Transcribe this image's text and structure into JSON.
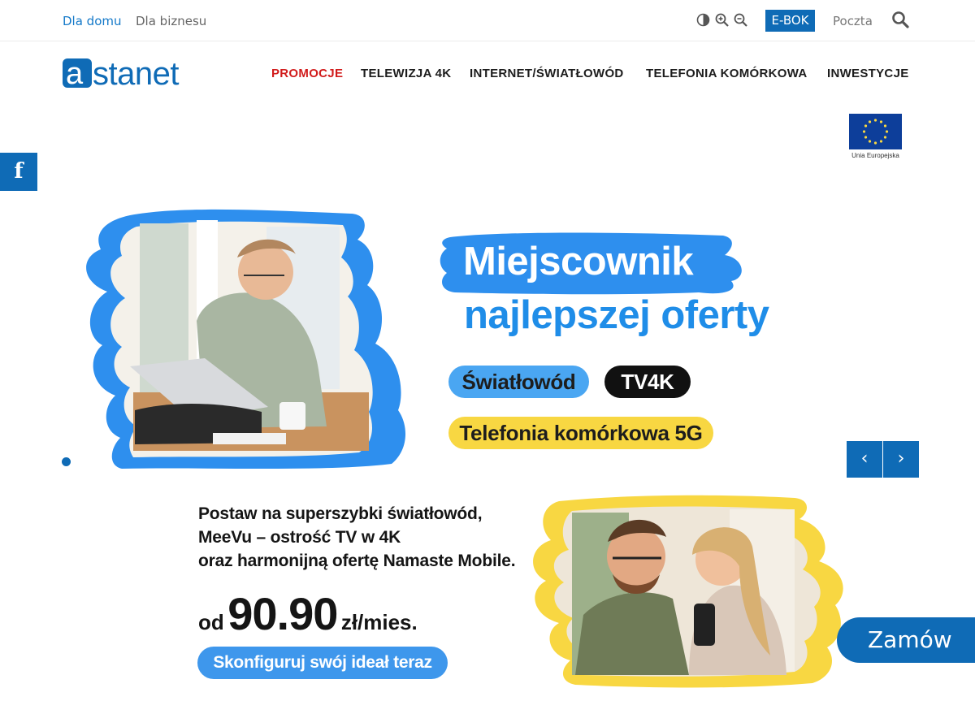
{
  "topbar": {
    "segment_home": "Dla domu",
    "segment_business": "Dla biznesu",
    "ebok": "E-BOK",
    "mail": "Poczta",
    "icons": [
      "contrast-icon",
      "zoom-in-icon",
      "zoom-out-icon",
      "search-icon"
    ]
  },
  "header": {
    "logo_text": "astanet",
    "nav": [
      {
        "label": "PROMOCJE",
        "active": true
      },
      {
        "label": "TELEWIZJA 4K"
      },
      {
        "label": "INTERNET/ŚWIATŁOWÓD"
      },
      {
        "label": "TELEFONIA KOMÓRKOWA"
      },
      {
        "label": "INWESTYCJE"
      }
    ],
    "eu_label": "Unia Europejska"
  },
  "social": {
    "facebook": "f"
  },
  "hero": {
    "headline_line1": "Miejscownik",
    "headline_line2": "najlepszej oferty",
    "pill_fiber": "Światłowód",
    "pill_tv": "TV4K",
    "pill_mobile": "Telefonia komórkowa 5G",
    "prev": "‹",
    "next": "›"
  },
  "promo": {
    "line1": "Postaw na superszybki światłowód,",
    "line2": "MeeVu – ostrość TV w 4K",
    "line3": "oraz harmonijną ofertę Namaste Mobile.",
    "price_prefix": "od",
    "price_value": "90.90",
    "price_unit": "zł/mies.",
    "cta": "Skonfiguruj swój ideał teraz"
  },
  "order_button": "Zamów",
  "colors": {
    "brand_blue": "#0f6bb6",
    "accent_red": "#d11b1b",
    "light_blue": "#4aa6f2",
    "headline_blue": "#1f8de8",
    "yellow": "#f8d742"
  }
}
